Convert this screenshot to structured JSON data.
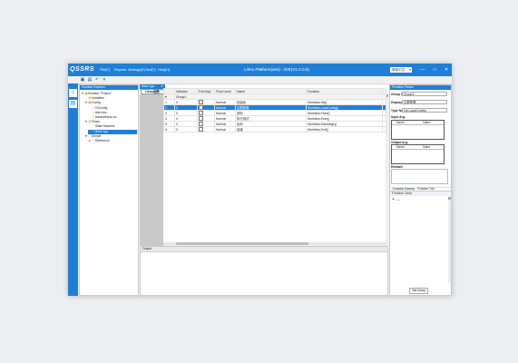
{
  "app": {
    "logo": "QSSRS",
    "menu": [
      "File(F)",
      "Reports",
      "Settings(S)",
      "Tool(T)",
      "Help(H)"
    ],
    "window_title": "Lilmo Platform(x64) - iOE(V1.0.0.0)",
    "language": "简体中文",
    "window_buttons": [
      "—",
      "□",
      "✕"
    ],
    "toolbar_icons": [
      "save-icon",
      "open-icon",
      "undo-icon",
      "close-icon"
    ],
    "side_icons": [
      "home-icon",
      "project-icon"
    ]
  },
  "solution": {
    "title": "Solution Explorer",
    "items": [
      {
        "text": "Solution \"Project\"",
        "indent": 0,
        "icon": "▣",
        "arrow": "▾"
      },
      {
        "text": "Variables",
        "indent": 1,
        "icon": "▤",
        "arrow": ""
      },
      {
        "text": "Config",
        "indent": 1,
        "icon": "▦",
        "arrow": "▾"
      },
      {
        "text": "IOConfig",
        "indent": 2,
        "icon": "▪",
        "arrow": ""
      },
      {
        "text": "test.xmx",
        "indent": 2,
        "icon": "▪",
        "arrow": ""
      },
      {
        "text": "tracimfiesna.xxr",
        "indent": 2,
        "icon": "▪",
        "arrow": ""
      },
      {
        "text": "Flows",
        "indent": 1,
        "icon": "▥",
        "arrow": "▾"
      },
      {
        "text": "State Machine",
        "indent": 2,
        "icon": "",
        "arrow": ""
      },
      {
        "text": "Base Lgo",
        "indent": 2,
        "icon": "▪",
        "arrow": "",
        "selected": true
      },
      {
        "text": "Simple",
        "indent": 1,
        "icon": "▢",
        "arrow": "▾"
      },
      {
        "text": "Reference",
        "indent": 2,
        "icon": "▪",
        "arrow": "▸"
      }
    ]
  },
  "editor": {
    "doc_tab": "Base Lgo",
    "close": "✕",
    "sub_tab": "Lilmo函数",
    "columns": [
      "",
      "Id/Action",
      "Full Stop",
      "Func Level",
      "Name",
      "Function",
      ""
    ],
    "group_label": "Group1",
    "rows": [
      {
        "num": "1",
        "id": "0",
        "level": "Normal",
        "name": "初始化",
        "function": "Workflow.Init()",
        "selected": false
      },
      {
        "num": "2",
        "id": "0",
        "level": "Normal",
        "name": "加载配置",
        "function": "Workflow.LoadConfig()",
        "selected": true
      },
      {
        "num": "3",
        "id": "0",
        "level": "Normal",
        "name": "进料",
        "function": "Workflow.Feed()",
        "selected": false
      },
      {
        "num": "4",
        "id": "0",
        "level": "Normal",
        "name": "执行测试",
        "function": "Workflow.Exec()",
        "selected": false
      },
      {
        "num": "5",
        "id": "0",
        "level": "Normal",
        "name": "出料",
        "function": "Workflow.Discharge()",
        "selected": false
      },
      {
        "num": "6",
        "id": "0",
        "level": "Normal",
        "name": "结束",
        "function": "Workflow.End()",
        "selected": false
      }
    ]
  },
  "output": {
    "title": "Output"
  },
  "function_param": {
    "title": "Function Param",
    "group_name_label": "Group Name:",
    "group_name_value": "Group1",
    "display_name_label": "Display Name:",
    "display_name_value": "加载配置",
    "type_name_label": "Type Name:",
    "type_name_value": "Init Load(Config)",
    "input_arg_label": "Input Arg:",
    "output_arg_label": "Output Arg:",
    "remark_label": "Remark:",
    "arg_cols": [
      "Name",
      "Value"
    ],
    "tabs": [
      "Function Params",
      "Function Tool"
    ]
  },
  "function_jump": {
    "title": "Function Jump",
    "add": "+",
    "remove": "—",
    "set_jump": "Set Jump"
  }
}
